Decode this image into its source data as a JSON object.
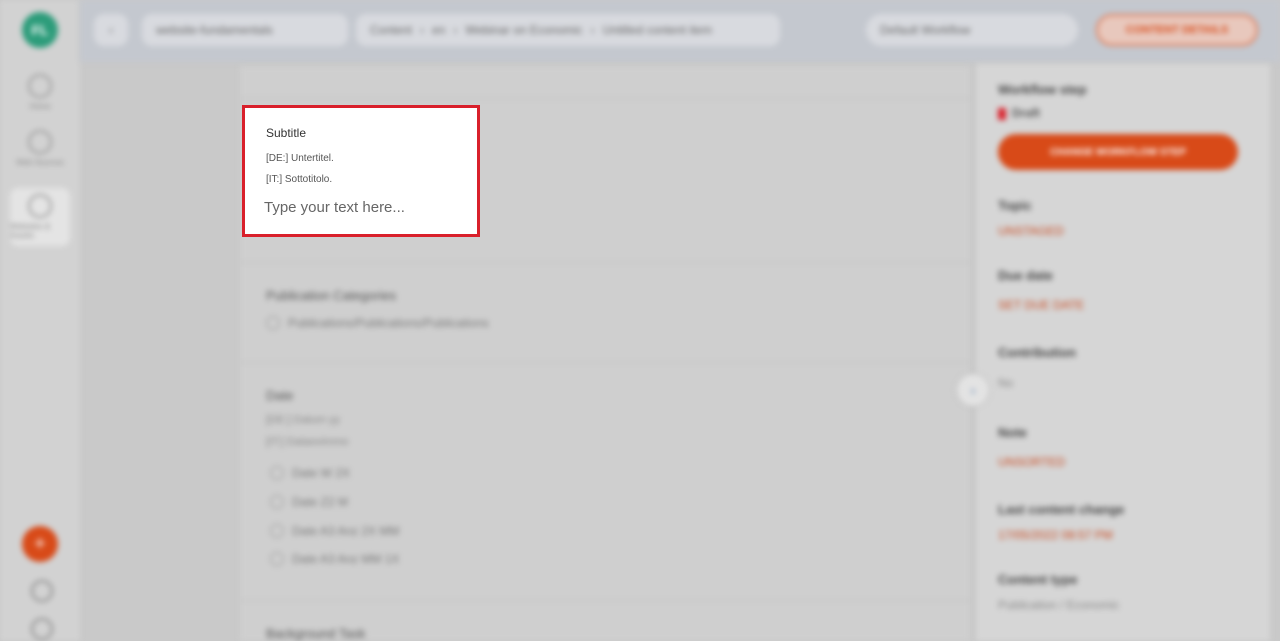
{
  "rail": {
    "logo": "FL",
    "items": [
      "Home",
      "Web Sources",
      "Websites & Assets"
    ]
  },
  "topbar": {
    "back_label": "‹",
    "workspace": "website-fundamentals",
    "breadcrumb": [
      "Content",
      "en",
      "Webinar on Economic",
      "Untitled content item"
    ],
    "workflow_filter": "Default Workflow",
    "details_button": "CONTENT DETAILS"
  },
  "main": {
    "categories_label": "Publication Categories",
    "categories_option": "Publications/Publications/Publications",
    "date_label": "Date",
    "date_translations": [
      "[DE:] Datum yy",
      "[IT:] Dataovimmo"
    ],
    "date_options": [
      "Date W 2X",
      "Date Z2 M",
      "Date A3 Anz 2X MM",
      "Date A3 Anz MM 1X"
    ],
    "next_section_label": "Background Task"
  },
  "subtitle_card": {
    "title": "Subtitle",
    "de": "[DE:] Untertitel.",
    "it": "[IT:] Sottotitolo.",
    "placeholder": "Type your text here..."
  },
  "right": {
    "workflow_step_label": "Workflow step",
    "workflow_step_value": "Draft",
    "change_button": "CHANGE WORKFLOW STEP",
    "fields": [
      {
        "label": "Topic",
        "value": "UNSTAGED"
      },
      {
        "label": "Due date",
        "value": "SET DUE DATE"
      },
      {
        "label": "Contribution",
        "value": "No"
      },
      {
        "label": "Note",
        "value": "UNSORTED"
      },
      {
        "label": "Last content change",
        "value": "17/05/2022 08:57 PM"
      },
      {
        "label": "Content type",
        "value": "Publication / Economic"
      }
    ]
  },
  "colors": {
    "accent": "#d84a18",
    "highlight": "#d9202b"
  }
}
